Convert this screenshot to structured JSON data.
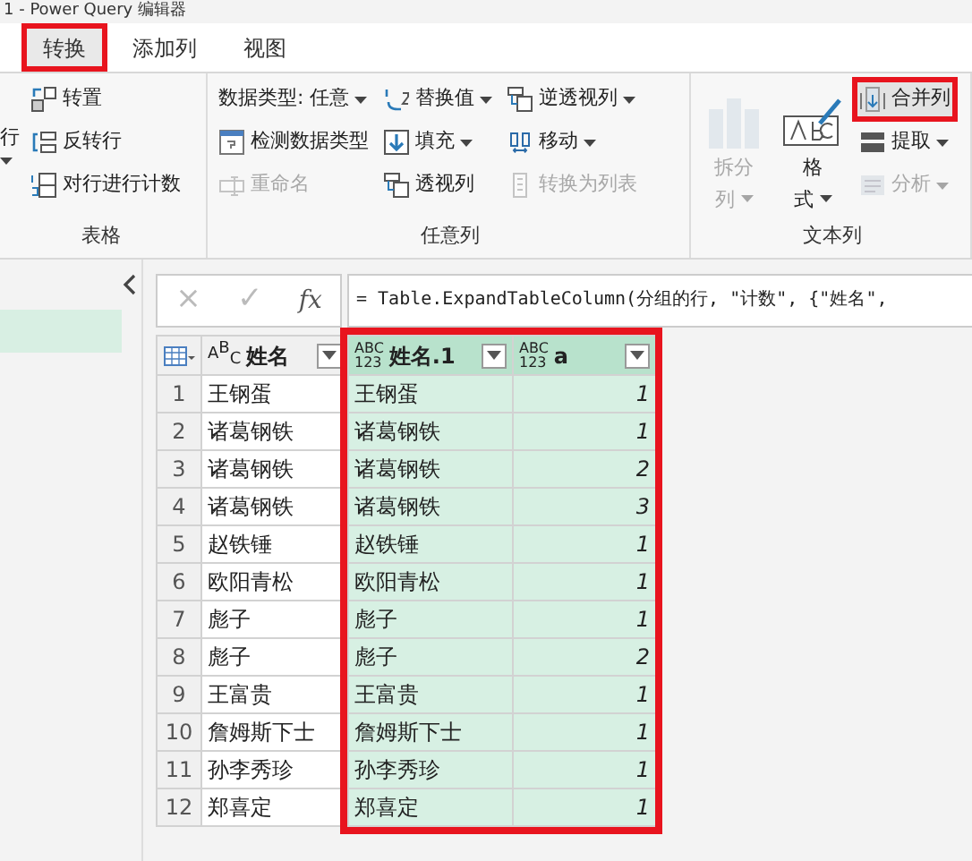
{
  "window": {
    "title": "1 - Power Query 编辑器"
  },
  "tabs": [
    {
      "label": "转换",
      "selected": true,
      "annotated": true
    },
    {
      "label": "添加列",
      "selected": false,
      "annotated": false
    },
    {
      "label": "视图",
      "selected": false,
      "annotated": false
    }
  ],
  "ribbon_groups": [
    {
      "label": "表格",
      "columns": [
        [
          {
            "kind": "partial",
            "label": "行",
            "dropdown": true
          }
        ],
        [
          {
            "kind": "small",
            "label": "转置",
            "dropdown": false,
            "disabled": false
          },
          {
            "kind": "small",
            "label": "反转行",
            "dropdown": false,
            "disabled": false
          },
          {
            "kind": "small",
            "label": "对行进行计数",
            "dropdown": false,
            "disabled": false
          }
        ]
      ]
    },
    {
      "label": "任意列",
      "columns": [
        [
          {
            "kind": "small",
            "label": "数据类型: 任意",
            "dropdown": true,
            "disabled": false
          },
          {
            "kind": "small",
            "label": "检测数据类型",
            "dropdown": false,
            "disabled": false
          },
          {
            "kind": "small",
            "label": "重命名",
            "dropdown": false,
            "disabled": true
          }
        ],
        [
          {
            "kind": "small",
            "label": "替换值",
            "dropdown": true,
            "disabled": false
          },
          {
            "kind": "small",
            "label": "填充",
            "dropdown": true,
            "disabled": false
          },
          {
            "kind": "small",
            "label": "透视列",
            "dropdown": false,
            "disabled": false
          }
        ],
        [
          {
            "kind": "small",
            "label": "逆透视列",
            "dropdown": true,
            "disabled": false
          },
          {
            "kind": "small",
            "label": "移动",
            "dropdown": true,
            "disabled": false
          },
          {
            "kind": "small",
            "label": "转换为列表",
            "dropdown": false,
            "disabled": true
          }
        ]
      ]
    },
    {
      "label": "文本列",
      "columns": [
        [
          {
            "kind": "large",
            "label": "拆分列",
            "dropdown": true,
            "disabled": true
          }
        ],
        [
          {
            "kind": "large",
            "label": "格式",
            "dropdown": true,
            "disabled": false
          }
        ],
        [
          {
            "kind": "small",
            "label": "合并列",
            "dropdown": false,
            "disabled": false,
            "annotated": true
          },
          {
            "kind": "small",
            "label": "提取",
            "dropdown": true,
            "disabled": false
          },
          {
            "kind": "small",
            "label": "分析",
            "dropdown": true,
            "disabled": true
          }
        ]
      ]
    }
  ],
  "formula_bar": {
    "cancel": "×",
    "confirm": "✓",
    "fx": "fx",
    "formula": "= Table.ExpandTableColumn(分组的行, \"计数\", {\"姓名\","
  },
  "table": {
    "columns": [
      {
        "label": "姓名",
        "kind": "text",
        "type_label": [
          "A",
          "B",
          "C"
        ],
        "highlighted": false,
        "annotated": false
      },
      {
        "label": "姓名.1",
        "kind": "any",
        "type_label": [
          "ABC",
          "123"
        ],
        "highlighted": true,
        "annotated": true
      },
      {
        "label": "a",
        "kind": "any",
        "type_label": [
          "ABC",
          "123"
        ],
        "highlighted": true,
        "annotated": true
      }
    ],
    "rows": [
      {
        "num": "1",
        "cells": [
          "王钢蛋",
          "王钢蛋",
          "1"
        ]
      },
      {
        "num": "2",
        "cells": [
          "诸葛钢铁",
          "诸葛钢铁",
          "1"
        ]
      },
      {
        "num": "3",
        "cells": [
          "诸葛钢铁",
          "诸葛钢铁",
          "2"
        ]
      },
      {
        "num": "4",
        "cells": [
          "诸葛钢铁",
          "诸葛钢铁",
          "3"
        ]
      },
      {
        "num": "5",
        "cells": [
          "赵铁锤",
          "赵铁锤",
          "1"
        ]
      },
      {
        "num": "6",
        "cells": [
          "欧阳青松",
          "欧阳青松",
          "1"
        ]
      },
      {
        "num": "7",
        "cells": [
          "彪子",
          "彪子",
          "1"
        ]
      },
      {
        "num": "8",
        "cells": [
          "彪子",
          "彪子",
          "2"
        ]
      },
      {
        "num": "9",
        "cells": [
          "王富贵",
          "王富贵",
          "1"
        ]
      },
      {
        "num": "10",
        "cells": [
          "詹姆斯下士",
          "詹姆斯下士",
          "1"
        ]
      },
      {
        "num": "11",
        "cells": [
          "孙李秀珍",
          "孙李秀珍",
          "1"
        ]
      },
      {
        "num": "12",
        "cells": [
          "郑喜定",
          "郑喜定",
          "1"
        ]
      }
    ]
  }
}
